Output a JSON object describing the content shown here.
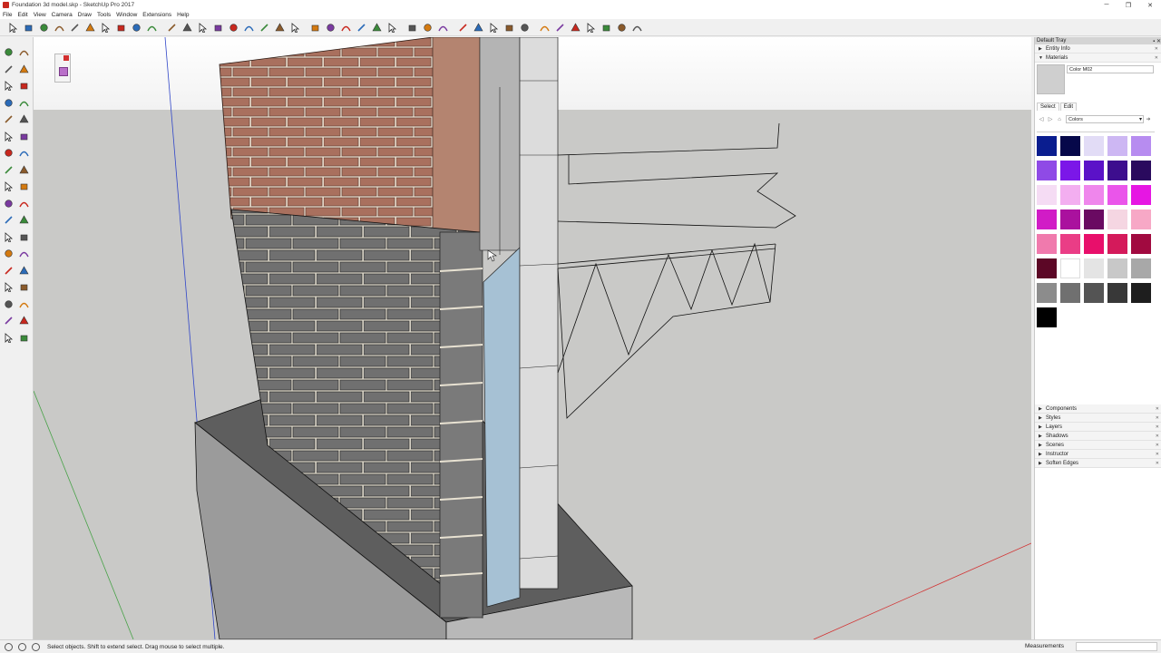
{
  "window": {
    "title": "Foundation 3d model.skp - SketchUp Pro 2017",
    "minimize": "─",
    "restore": "❐",
    "close": "✕"
  },
  "menu": [
    "File",
    "Edit",
    "View",
    "Camera",
    "Draw",
    "Tools",
    "Window",
    "Extensions",
    "Help"
  ],
  "toolbar_icons": [
    "select-icon",
    "eraser-icon",
    "line-icon",
    "arc-icon",
    "rectangle-icon",
    "circle-icon",
    "polygon-icon",
    "push-pull-icon",
    "move-icon",
    "rotate-icon",
    "scale-icon",
    "offset-icon",
    "paint-bucket-icon",
    "tape-measure-icon",
    "dimension-icon",
    "protractor-icon",
    "text-icon",
    "axes-icon",
    "3d-text-icon",
    "orbit-icon",
    "pan-icon",
    "zoom-icon",
    "zoom-window-icon",
    "zoom-extents-icon",
    "position-camera-icon",
    "walk-icon",
    "look-around-icon",
    "section-plane-icon",
    "xray-icon",
    "wireframe-icon",
    "hidden-line-icon",
    "shaded-icon",
    "shaded-textures-icon",
    "monochrome-icon",
    "iso-view-icon",
    "top-view-icon",
    "front-view-icon",
    "right-view-icon",
    "back-view-icon",
    "left-view-icon"
  ],
  "tray": {
    "title": "Default Tray",
    "panels_top": [
      "Entity Info",
      "Materials"
    ],
    "material_name": "Color M02",
    "tabs": [
      "Select",
      "Edit"
    ],
    "collection": "Colors",
    "swatches": [
      "#0a1d8f",
      "#06084a",
      "#e2dcf6",
      "#cdb7f3",
      "#b78cf0",
      "#8f4ae6",
      "#7b17e8",
      "#5b12c8",
      "#3d0e8e",
      "#2a0a5e",
      "#f5dcf4",
      "#f3aef0",
      "#ef86ec",
      "#ea55ea",
      "#e616e3",
      "#d11cc6",
      "#aa119e",
      "#6a0a62",
      "#f5d6e2",
      "#f7a8c6",
      "#f07aad",
      "#ea3d86",
      "#e80f6b",
      "#d41a5b",
      "#a10a40",
      "#5c0726",
      "#ffffff",
      "#e4e4e4",
      "#c8c8c8",
      "#a8a8a8",
      "#8c8c8c",
      "#707070",
      "#545454",
      "#383838",
      "#1e1e1e",
      "#000000"
    ],
    "panels_bottom": [
      "Components",
      "Styles",
      "Layers",
      "Shadows",
      "Scenes",
      "Instructor",
      "Soften Edges"
    ]
  },
  "status": {
    "message": "Select objects. Shift to extend select. Drag mouse to select multiple.",
    "measurements_label": "Measurements"
  },
  "colors": {
    "brick": "#a67260",
    "block": "#6e6e6e",
    "insulation": "#a9c4d6",
    "wood": "#d7d7d7",
    "footing": "#6a6a6a",
    "background": "#c8c8c6"
  }
}
